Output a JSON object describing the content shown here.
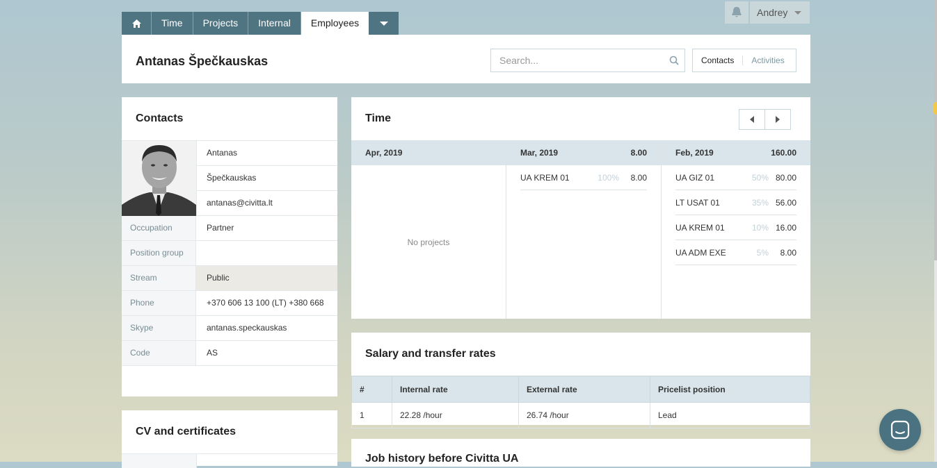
{
  "nav": {
    "tabs": [
      {
        "label": "Time"
      },
      {
        "label": "Projects"
      },
      {
        "label": "Internal"
      },
      {
        "label": "Employees"
      }
    ],
    "active_tab": "Employees"
  },
  "user": {
    "name": "Andrey"
  },
  "header": {
    "title": "Antanas Špečkauskas",
    "search_placeholder": "Search...",
    "segments": [
      "Contacts",
      "Activities"
    ]
  },
  "contacts": {
    "title": "Contacts",
    "first_name": "Antanas",
    "last_name": "Špečkauskas",
    "email": "antanas@civitta.lt",
    "fields": [
      {
        "label": "Occupation",
        "value": "Partner"
      },
      {
        "label": "Position group",
        "value": ""
      },
      {
        "label": "Stream",
        "value": "Public"
      },
      {
        "label": "Phone",
        "value": "+370 606 13 100 (LT) +380 668"
      },
      {
        "label": "Skype",
        "value": "antanas.speckauskas"
      },
      {
        "label": "Code",
        "value": "AS"
      }
    ]
  },
  "cv": {
    "title": "CV and certificates"
  },
  "time": {
    "title": "Time",
    "months": [
      {
        "name": "Apr, 2019",
        "total": "",
        "empty_text": "No projects",
        "rows": []
      },
      {
        "name": "Mar, 2019",
        "total": "8.00",
        "rows": [
          {
            "project": "UA KREM 01",
            "pct": "100%",
            "hours": "8.00"
          }
        ]
      },
      {
        "name": "Feb, 2019",
        "total": "160.00",
        "rows": [
          {
            "project": "UA GIZ 01",
            "pct": "50%",
            "hours": "80.00"
          },
          {
            "project": "LT USAT 01",
            "pct": "35%",
            "hours": "56.00"
          },
          {
            "project": "UA KREM 01",
            "pct": "10%",
            "hours": "16.00"
          },
          {
            "project": "UA ADM EXE",
            "pct": "5%",
            "hours": "8.00"
          }
        ]
      }
    ]
  },
  "salary": {
    "title": "Salary and transfer rates",
    "headers": [
      "#",
      "Internal rate",
      "External rate",
      "Pricelist position"
    ],
    "rows": [
      [
        "1",
        "22.28 /hour",
        "26.74 /hour",
        "Lead"
      ]
    ]
  },
  "jobs": {
    "title": "Job history before Civitta UA"
  },
  "colors": {
    "nav_bg": "#4f7582",
    "accent_header": "#d9e5ea",
    "chat_bg": "#4a7280"
  },
  "icons": [
    "home-icon",
    "chevron-down-icon",
    "bell-icon",
    "search-icon",
    "arrow-left-icon",
    "arrow-right-icon",
    "chat-icon"
  ]
}
